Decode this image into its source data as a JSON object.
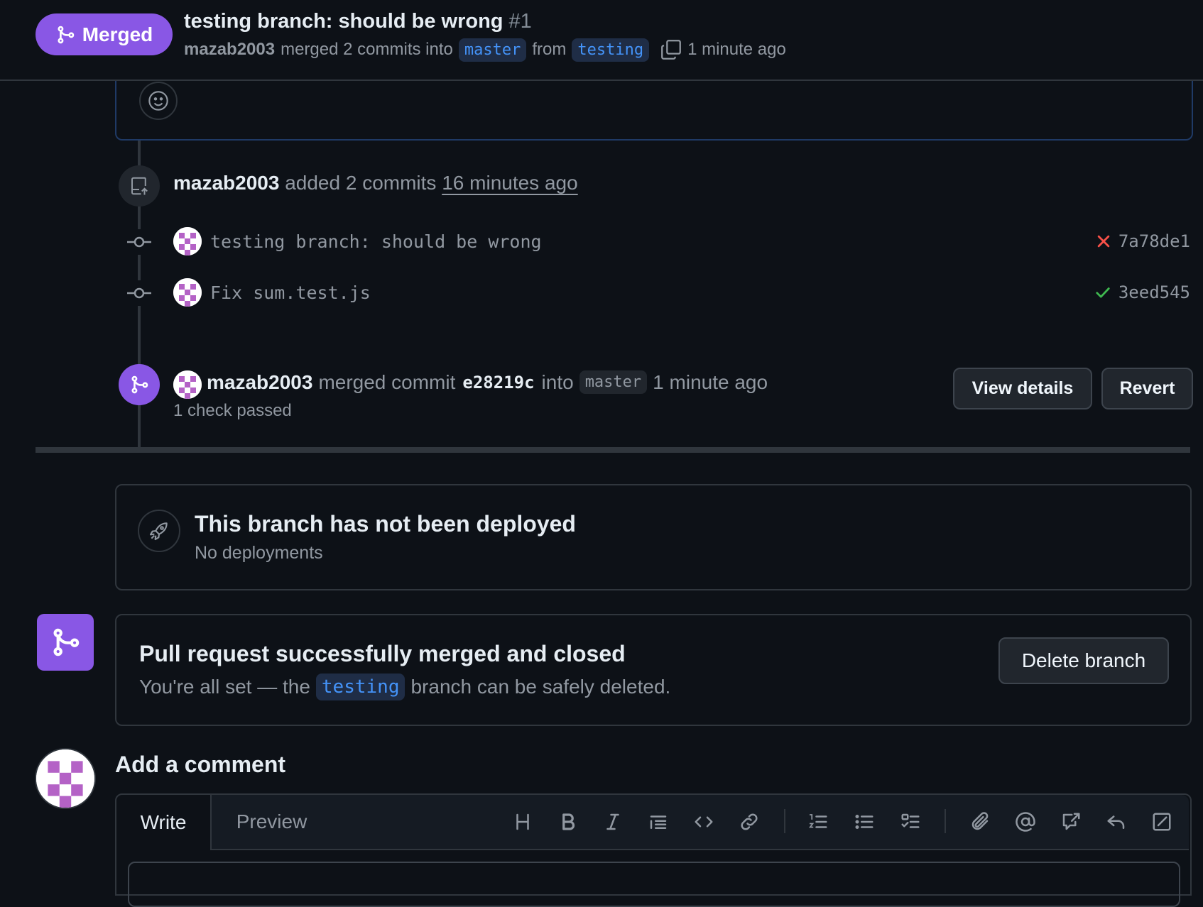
{
  "header": {
    "status": "Merged",
    "title": "testing branch: should be wrong",
    "number": "#1",
    "author": "mazab2003",
    "merged_text": "merged 2 commits into",
    "base_branch": "master",
    "from_text": "from",
    "head_branch": "testing",
    "time": "1 minute ago"
  },
  "push_event": {
    "author": "mazab2003",
    "text": "added 2 commits",
    "time": "16 minutes ago"
  },
  "commits": [
    {
      "message": "testing branch: should be wrong",
      "status": "failed",
      "sha": "7a78de1"
    },
    {
      "message": "Fix sum.test.js",
      "status": "success",
      "sha": "3eed545"
    }
  ],
  "merge_event": {
    "author": "mazab2003",
    "text": "merged commit",
    "sha": "e28219c",
    "into_text": "into",
    "branch": "master",
    "time": "1 minute ago",
    "checks": "1 check passed",
    "view_details_label": "View details",
    "revert_label": "Revert"
  },
  "deployment": {
    "title": "This branch has not been deployed",
    "subtitle": "No deployments"
  },
  "merged_box": {
    "title": "Pull request successfully merged and closed",
    "sub_prefix": "You're all set — the",
    "branch": "testing",
    "sub_suffix": "branch can be safely deleted.",
    "delete_label": "Delete branch"
  },
  "comment": {
    "title": "Add a comment",
    "tab_write": "Write",
    "tab_preview": "Preview"
  },
  "toolbar_icons": [
    "heading-icon",
    "bold-icon",
    "italic-icon",
    "quote-icon",
    "code-icon",
    "link-icon",
    "ordered-list-icon",
    "unordered-list-icon",
    "task-list-icon",
    "attach-icon",
    "mention-icon",
    "reference-icon",
    "reply-icon",
    "fullscreen-icon"
  ],
  "colors": {
    "background": "#0d1117",
    "merged_purple": "#8957e5",
    "border": "#30363d",
    "link_blue": "#4493f8",
    "fail_red": "#f85149",
    "success_green": "#3fb950"
  }
}
